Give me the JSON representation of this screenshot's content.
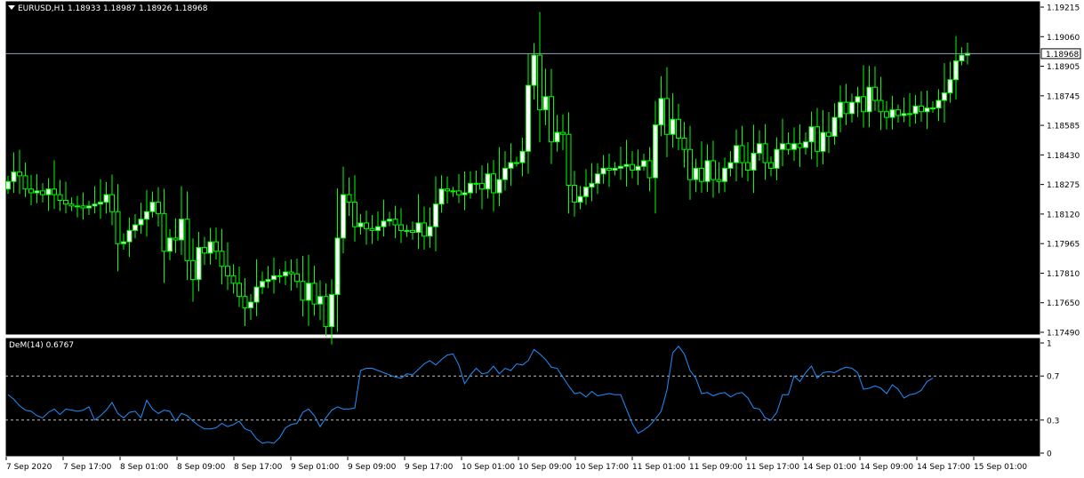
{
  "window": {
    "symbol_header": "EURUSD,H1  1.18933 1.18987 1.18926 1.18968",
    "current_price_label": "1.18968",
    "indicator_header": "DeM(14) 0.6767"
  },
  "colors": {
    "background": "#000000",
    "frame": "#ffffff",
    "bull_fill": "#ffffff",
    "candle_line": "#00ff00",
    "price_line": "#8fa3b8",
    "indicator_line": "#1e90ff",
    "level_line": "#c0c0c0",
    "axis_text": "#000000"
  },
  "chart_data": [
    {
      "type": "candlestick",
      "title": "EURUSD,H1",
      "ohlc_last": {
        "open": 1.18933,
        "high": 1.18987,
        "low": 1.18926,
        "close": 1.18968
      },
      "current_price": 1.18968,
      "ylim": [
        1.1749,
        1.19215
      ],
      "y_ticks": [
        "1.19215",
        "1.19060",
        "1.18905",
        "1.18745",
        "1.18585",
        "1.18430",
        "1.18275",
        "1.18120",
        "1.17965",
        "1.17810",
        "1.17650",
        "1.17490"
      ],
      "x_ticks": [
        "7 Sep 2020",
        "7 Sep 17:00",
        "8 Sep 01:00",
        "8 Sep 09:00",
        "8 Sep 17:00",
        "9 Sep 01:00",
        "9 Sep 09:00",
        "9 Sep 17:00",
        "10 Sep 01:00",
        "10 Sep 09:00",
        "10 Sep 17:00",
        "11 Sep 01:00",
        "11 Sep 09:00",
        "11 Sep 17:00",
        "14 Sep 01:00",
        "14 Sep 09:00",
        "14 Sep 17:00",
        "15 Sep 01:00"
      ],
      "grid": false,
      "closes": [
        1.1829,
        1.1834,
        1.1832,
        1.1825,
        1.1823,
        1.1824,
        1.1822,
        1.1825,
        1.1822,
        1.1819,
        1.1817,
        1.1816,
        1.1816,
        1.1815,
        1.1816,
        1.1817,
        1.1818,
        1.1822,
        1.1813,
        1.1796,
        1.1797,
        1.1803,
        1.1806,
        1.1809,
        1.1813,
        1.1818,
        1.1812,
        1.1792,
        1.1799,
        1.1798,
        1.1809,
        1.1787,
        1.1777,
        1.1794,
        1.1791,
        1.1797,
        1.1792,
        1.1784,
        1.1779,
        1.1775,
        1.1768,
        1.1762,
        1.1765,
        1.1773,
        1.1776,
        1.1777,
        1.1779,
        1.1779,
        1.1781,
        1.178,
        1.1776,
        1.1766,
        1.1775,
        1.1764,
        1.1768,
        1.1752,
        1.1769,
        1.1799,
        1.1822,
        1.1818,
        1.1805,
        1.1807,
        1.1804,
        1.1803,
        1.1805,
        1.1808,
        1.1809,
        1.1806,
        1.1803,
        1.1803,
        1.1802,
        1.1807,
        1.18,
        1.1805,
        1.1817,
        1.1825,
        1.1824,
        1.1824,
        1.1822,
        1.1823,
        1.1828,
        1.1828,
        1.1825,
        1.1833,
        1.1823,
        1.183,
        1.1836,
        1.1839,
        1.1839,
        1.1845,
        1.188,
        1.1896,
        1.1867,
        1.1874,
        1.185,
        1.1855,
        1.1854,
        1.1827,
        1.1818,
        1.1821,
        1.1826,
        1.1828,
        1.1833,
        1.1836,
        1.1835,
        1.1836,
        1.1837,
        1.1838,
        1.1835,
        1.1837,
        1.184,
        1.1831,
        1.1859,
        1.1873,
        1.1854,
        1.1862,
        1.1852,
        1.1846,
        1.183,
        1.1836,
        1.1829,
        1.184,
        1.183,
        1.1829,
        1.1836,
        1.1839,
        1.1848,
        1.1839,
        1.1835,
        1.1844,
        1.1849,
        1.1839,
        1.1836,
        1.1846,
        1.1849,
        1.1846,
        1.1849,
        1.1847,
        1.185,
        1.1858,
        1.1845,
        1.1855,
        1.1853,
        1.1863,
        1.1871,
        1.1865,
        1.1871,
        1.1874,
        1.1866,
        1.1879,
        1.1872,
        1.1866,
        1.1863,
        1.1867,
        1.1864,
        1.1865,
        1.1865,
        1.1869,
        1.1866,
        1.1868,
        1.1868,
        1.1872,
        1.1876,
        1.1883,
        1.1893,
        1.1896,
        1.1897
      ]
    },
    {
      "type": "line",
      "title": "DeM(14) 0.6767",
      "series": [
        {
          "name": "DeM(14)",
          "values": [
            0.53,
            0.49,
            0.43,
            0.39,
            0.38,
            0.34,
            0.32,
            0.37,
            0.4,
            0.35,
            0.4,
            0.39,
            0.38,
            0.39,
            0.42,
            0.3,
            0.34,
            0.39,
            0.46,
            0.36,
            0.32,
            0.37,
            0.38,
            0.32,
            0.48,
            0.4,
            0.36,
            0.39,
            0.38,
            0.29,
            0.36,
            0.34,
            0.29,
            0.25,
            0.22,
            0.22,
            0.23,
            0.27,
            0.24,
            0.26,
            0.29,
            0.22,
            0.2,
            0.13,
            0.09,
            0.1,
            0.09,
            0.14,
            0.23,
            0.26,
            0.27,
            0.37,
            0.4,
            0.34,
            0.24,
            0.32,
            0.39,
            0.42,
            0.4,
            0.4,
            0.41,
            0.75,
            0.77,
            0.77,
            0.75,
            0.73,
            0.71,
            0.69,
            0.68,
            0.72,
            0.71,
            0.76,
            0.81,
            0.84,
            0.8,
            0.85,
            0.89,
            0.9,
            0.8,
            0.63,
            0.71,
            0.77,
            0.72,
            0.73,
            0.79,
            0.72,
            0.77,
            0.75,
            0.81,
            0.8,
            0.84,
            0.94,
            0.9,
            0.85,
            0.78,
            0.77,
            0.69,
            0.61,
            0.54,
            0.55,
            0.51,
            0.56,
            0.52,
            0.53,
            0.54,
            0.53,
            0.53,
            0.4,
            0.27,
            0.18,
            0.21,
            0.25,
            0.31,
            0.38,
            0.57,
            0.91,
            0.97,
            0.9,
            0.75,
            0.68,
            0.54,
            0.55,
            0.52,
            0.54,
            0.55,
            0.51,
            0.54,
            0.55,
            0.5,
            0.41,
            0.4,
            0.32,
            0.3,
            0.37,
            0.53,
            0.53,
            0.7,
            0.65,
            0.73,
            0.79,
            0.68,
            0.73,
            0.74,
            0.73,
            0.76,
            0.78,
            0.77,
            0.73,
            0.58,
            0.59,
            0.61,
            0.59,
            0.54,
            0.62,
            0.58,
            0.5,
            0.53,
            0.54,
            0.57,
            0.65,
            0.68
          ]
        }
      ],
      "ylim": [
        0,
        1
      ],
      "y_ticks": [
        "1",
        "0.7",
        "0.3",
        "0"
      ],
      "levels": [
        0.7,
        0.3
      ]
    }
  ]
}
